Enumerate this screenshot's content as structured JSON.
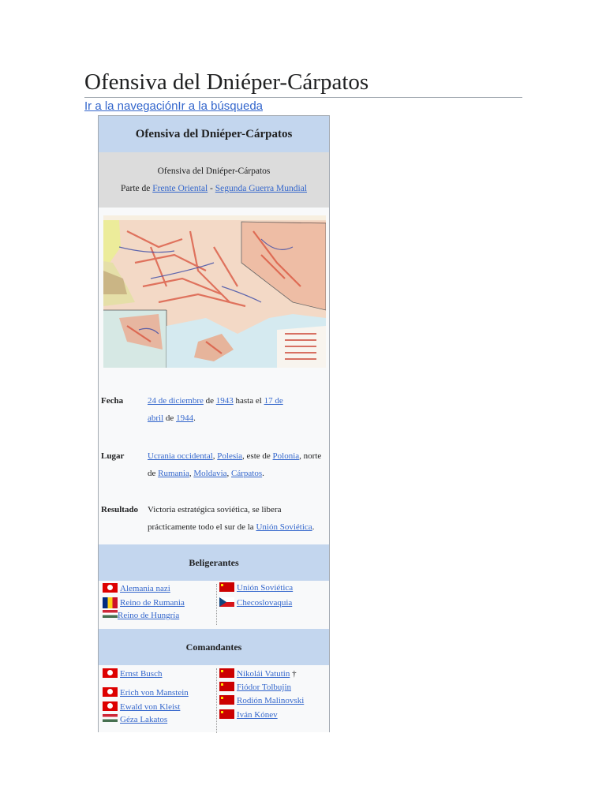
{
  "page": {
    "title": "Ofensiva del Dniéper-Cárpatos",
    "skip_nav": "Ir a la navegación",
    "skip_search": "Ir a la búsqueda"
  },
  "infobox": {
    "header": "Ofensiva del Dniéper-Cárpatos",
    "subtitle": "Ofensiva del Dniéper-Cárpatos",
    "part_of_prefix": "Parte de",
    "part_of_link1": "Frente Oriental",
    "part_of_sep": "-",
    "part_of_link2": "Segunda Guerra Mundial",
    "fecha": {
      "label": "Fecha",
      "day1": "24 de diciembre",
      "t1": "de",
      "year1": "1943",
      "t2": "hasta el",
      "day2a": "17 de",
      "day2b": "abril",
      "t3": "de",
      "year2": "1944",
      "t4": "."
    },
    "lugar": {
      "label": "Lugar",
      "l1": "Ucrania occidental",
      "c1": ",",
      "l2": "Polesia",
      "t1": ", este de",
      "l3": "Polonia",
      "t2": ", norte",
      "t3": "de",
      "l4": "Rumania",
      "c2": ",",
      "l5": "Moldavia",
      "c3": ",",
      "l6": "Cárpatos",
      "t4": "."
    },
    "resultado": {
      "label": "Resultado",
      "t1": "Victoria estratégica soviética, se libera",
      "t2": "prácticamente todo el sur de la",
      "link": "Unión Soviética",
      "t3": "."
    },
    "belligerents": {
      "header": "Beligerantes",
      "side1": [
        {
          "flag": "nazi-germany-flag",
          "name": "Alemania nazi"
        },
        {
          "flag": "romania-flag",
          "name": "Reino de Rumania"
        },
        {
          "flag": "hungary-flag",
          "name": "Reino de Hungría"
        }
      ],
      "side2": [
        {
          "flag": "soviet-flag",
          "name": "Unión Soviética"
        },
        {
          "flag": "czechoslovakia-flag",
          "name": "Checoslovaquia"
        }
      ]
    },
    "commanders": {
      "header": "Comandantes",
      "side1": [
        {
          "flag": "nazi-germany-flag",
          "name": "Ernst Busch"
        },
        {
          "flag": "nazi-germany-flag",
          "name": "Erich von Manstein"
        },
        {
          "flag": "nazi-germany-flag",
          "name": "Ewald von Kleist"
        },
        {
          "flag": "hungary-flag",
          "name": "Géza Lakatos"
        }
      ],
      "side2": [
        {
          "flag": "soviet-flag",
          "name": "Nikolái Vatutin",
          "suffix": "†"
        },
        {
          "flag": "soviet-flag",
          "name": "Fiódor Tolbujin"
        },
        {
          "flag": "soviet-flag",
          "name": "Rodión Malinovski"
        },
        {
          "flag": "soviet-flag",
          "name": "Iván Kónev"
        }
      ]
    }
  }
}
